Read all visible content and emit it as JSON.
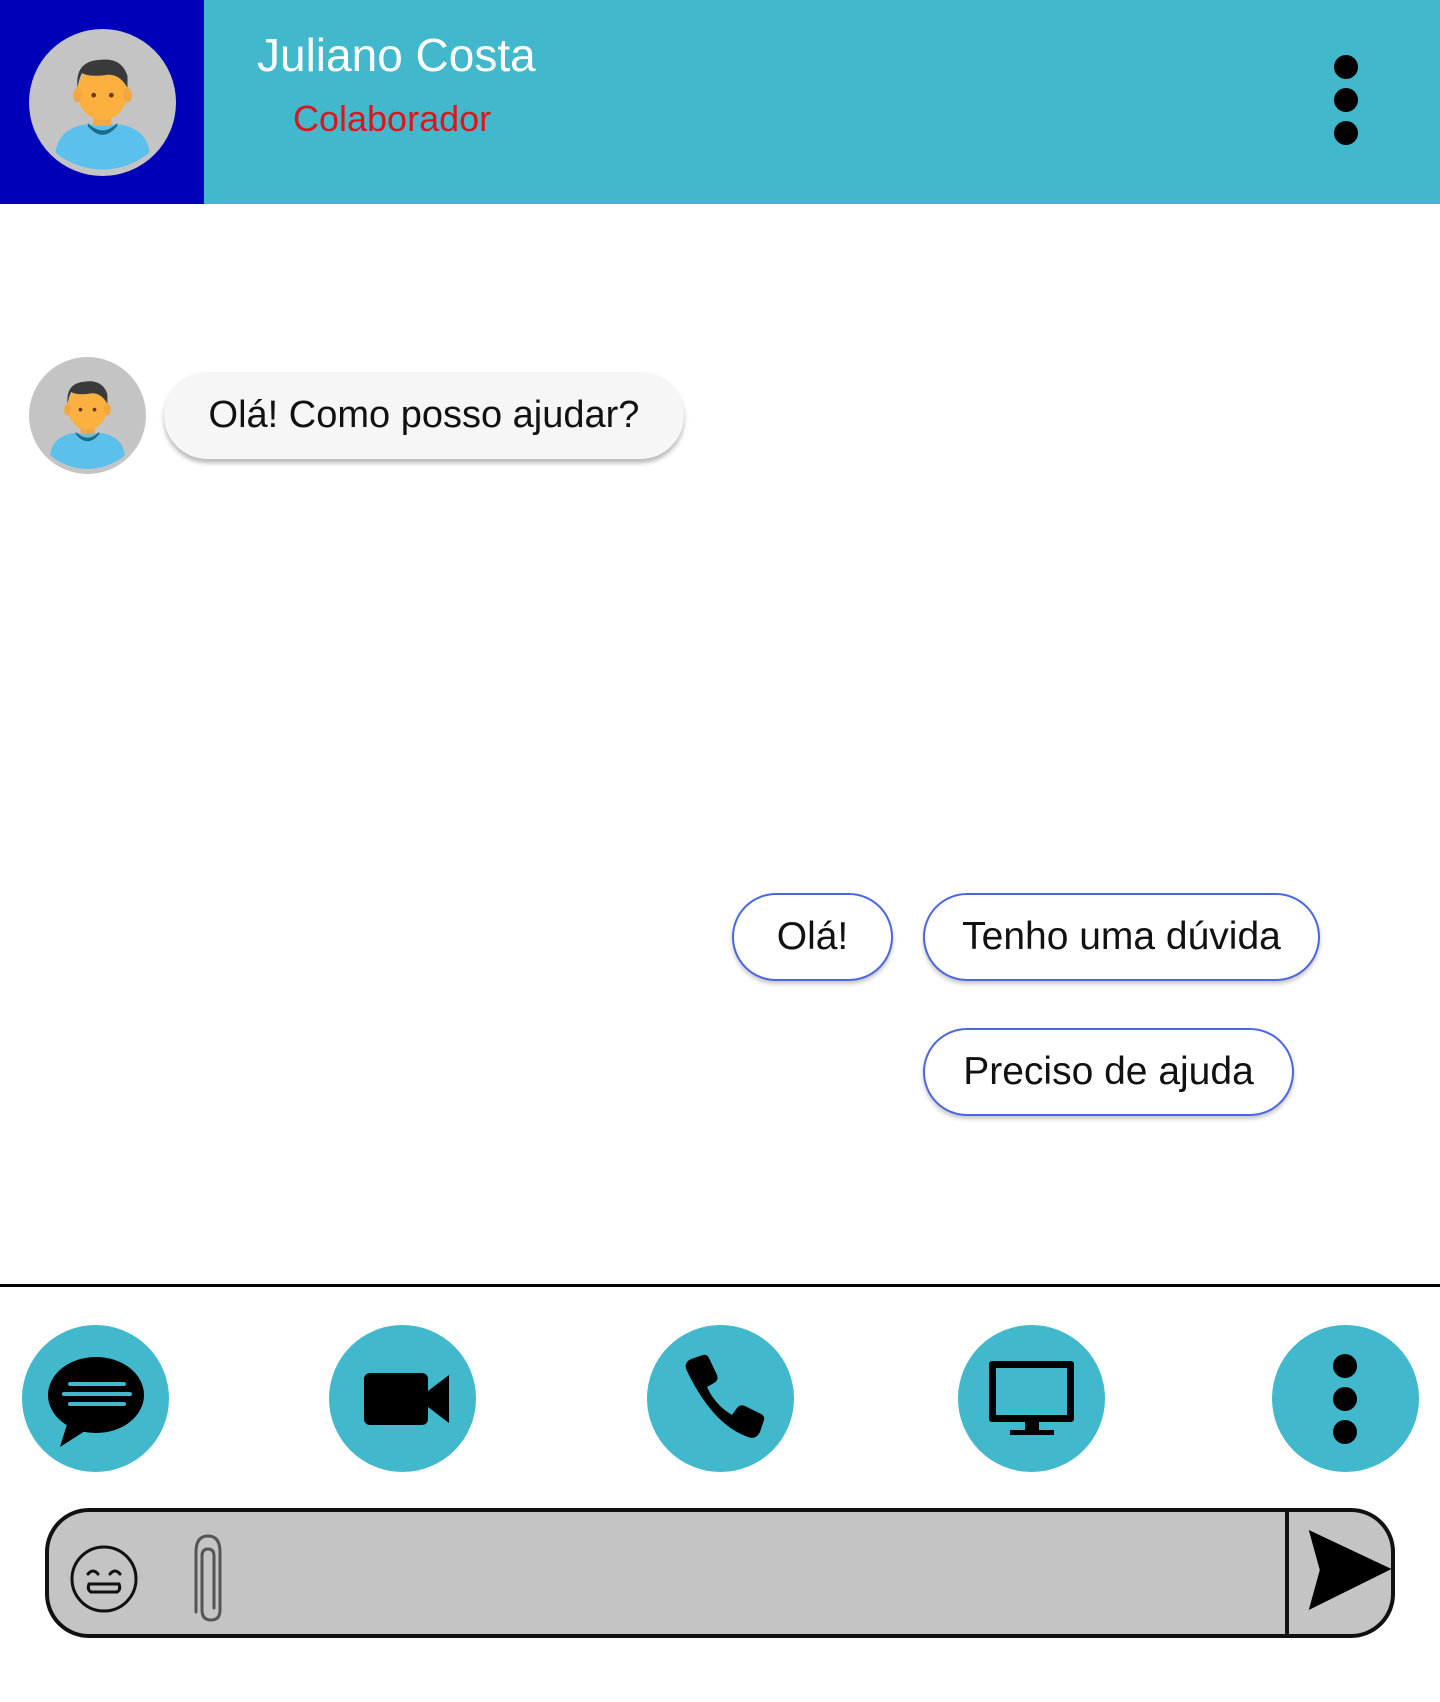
{
  "colors": {
    "header_bg": "#41b8cc",
    "avatar_panel_bg": "#0000b8",
    "role_text": "#e0151b",
    "action_button_bg": "#41b8cc",
    "reply_border": "#4a66e0",
    "composer_bg": "#c4c4c4"
  },
  "header": {
    "name": "Juliano Costa",
    "role": "Colaborador",
    "avatar_icon": "user-avatar-icon",
    "menu_icon": "more-vertical-icon"
  },
  "messages": [
    {
      "from": "agent",
      "text": "Olá! Como posso ajudar?"
    }
  ],
  "quick_replies": [
    "Olá!",
    "Tenho uma dúvida",
    "Preciso de ajuda"
  ],
  "actions": [
    {
      "icon": "chat-icon"
    },
    {
      "icon": "video-camera-icon"
    },
    {
      "icon": "phone-icon"
    },
    {
      "icon": "screen-share-icon"
    },
    {
      "icon": "more-vertical-icon"
    }
  ],
  "composer": {
    "placeholder": "",
    "emoji_icon": "emoji-icon",
    "attach_icon": "paperclip-icon",
    "send_icon": "send-icon"
  }
}
